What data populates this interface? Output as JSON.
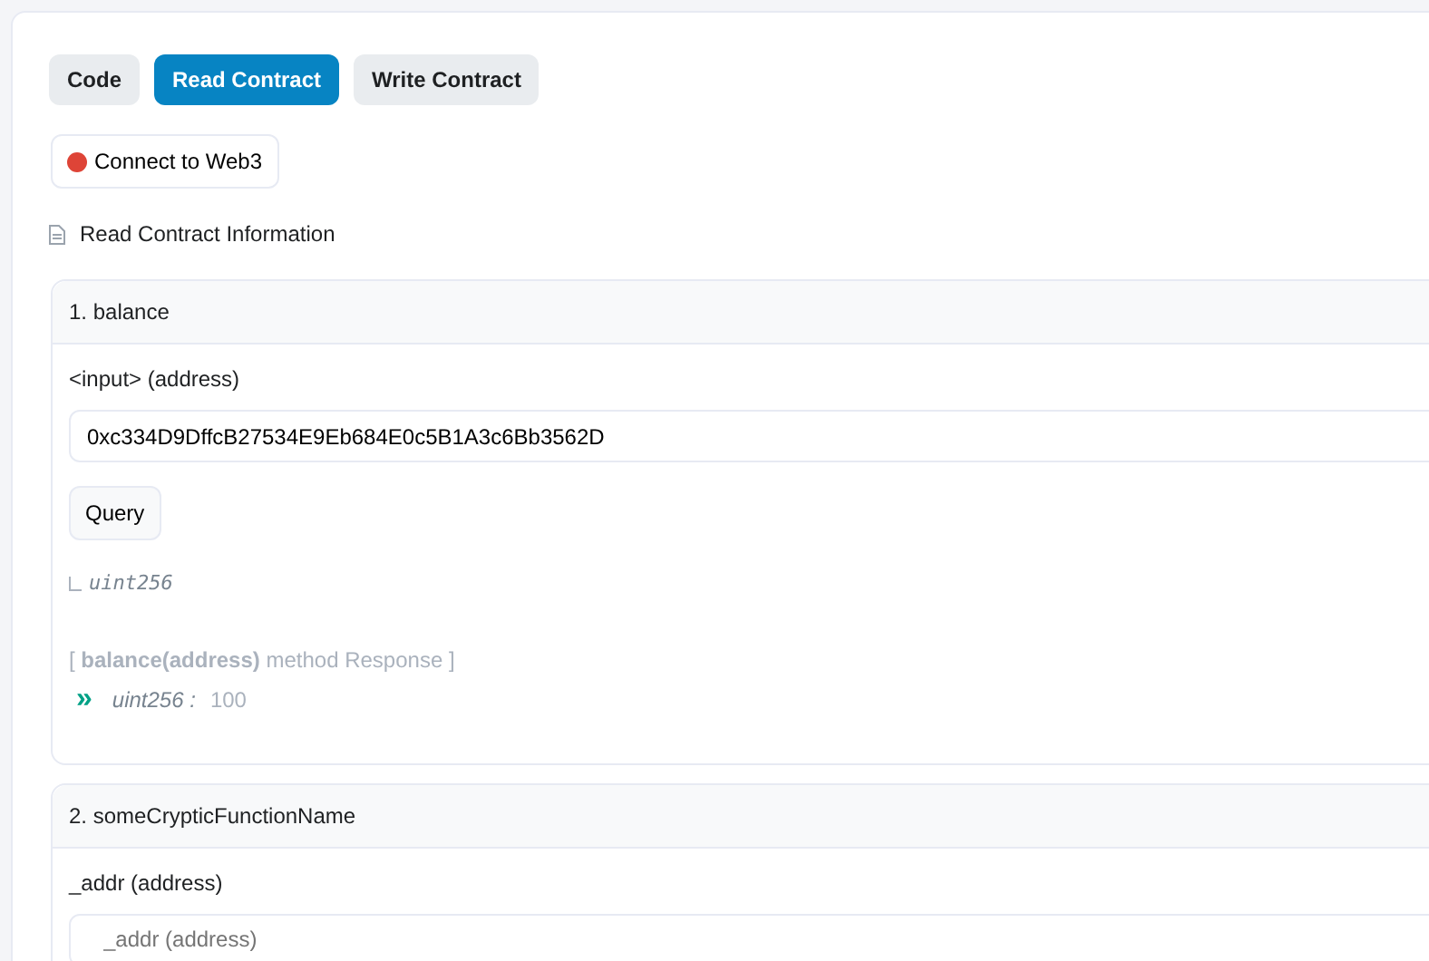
{
  "tabs": [
    {
      "label": "Code",
      "selected": false
    },
    {
      "label": "Read Contract",
      "selected": true
    },
    {
      "label": "Write Contract",
      "selected": false
    }
  ],
  "connect": {
    "label": "Connect to Web3",
    "connected": false
  },
  "info": "Read Contract Information",
  "functions": [
    {
      "title": "1. balance",
      "inputs": [
        {
          "label": "<input> (address)",
          "value": "0xc334D9DffcB27534E9Eb684E0c5B1A3c6Bb3562D"
        }
      ],
      "button": "Query",
      "output_type": "uint256",
      "response": {
        "header": "[ **balance(address)** method Response ]",
        "arrow": "»",
        "type": "uint256 :",
        "value": "100"
      }
    },
    {
      "title": "2. someCrypticFunctionName",
      "inputs": [
        {
          "label": "_addr (address)",
          "placeholder": "_addr (address)"
        }
      ]
    }
  ]
}
